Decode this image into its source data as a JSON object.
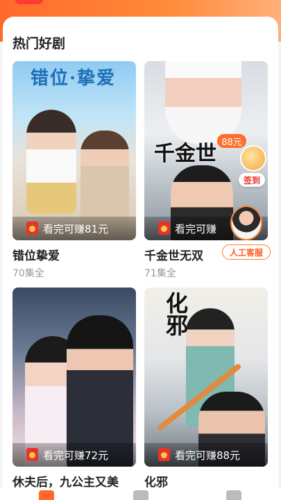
{
  "section": {
    "title": "热门好剧"
  },
  "dramas": [
    {
      "title": "错位挚爱",
      "episodes": "70集全",
      "earn": "看完可赚81元",
      "poster_text": "错位·挚爱"
    },
    {
      "title": "千金世无双",
      "episodes": "71集全",
      "earn": "看完可赚",
      "poster_text": "千金世"
    },
    {
      "title": "休夫后，九公主又美",
      "episodes": "",
      "earn": "看完可赚72元",
      "poster_text": ""
    },
    {
      "title": "化邪",
      "episodes": "",
      "earn": "看完可赚88元",
      "poster_text": "化邪"
    }
  ],
  "floating": {
    "reward_badge": "88元",
    "sign_label": "签到",
    "service_label": "人工客服"
  },
  "colors": {
    "accent": "#ff6a2a",
    "redpack": "#e8332a",
    "title": "#222222",
    "subtitle": "#999999"
  },
  "icons": [
    "redpack-icon",
    "sign-in-icon",
    "customer-service-avatar",
    "home-tab-icon",
    "theater-tab-icon",
    "profile-tab-icon"
  ]
}
